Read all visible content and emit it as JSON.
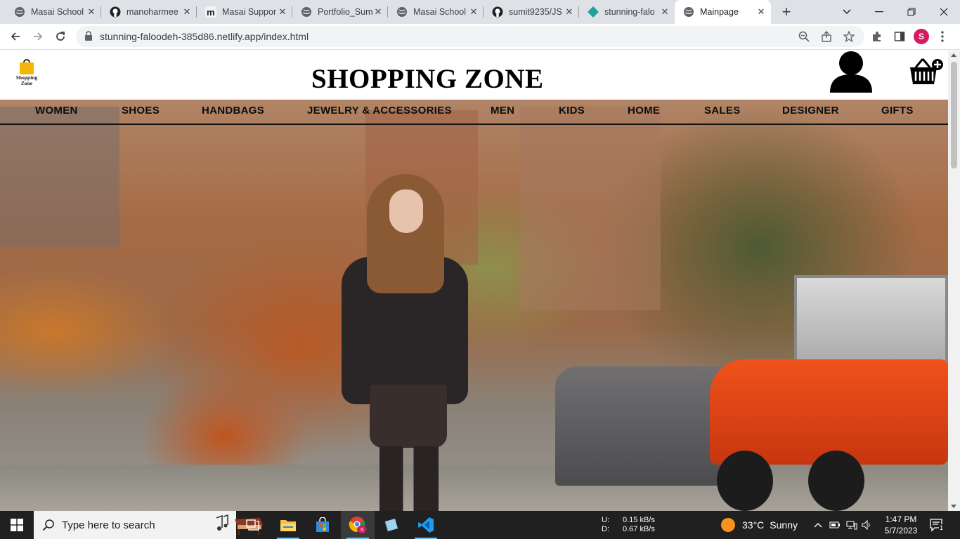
{
  "browser": {
    "tabs": [
      {
        "title": "Masai School",
        "icon": "globe-icon"
      },
      {
        "title": "manoharmee",
        "icon": "github-icon"
      },
      {
        "title": "Masai Suppor",
        "icon": "masai-m-icon"
      },
      {
        "title": "Portfolio_Sum",
        "icon": "globe-icon"
      },
      {
        "title": "Masai School",
        "icon": "globe-icon"
      },
      {
        "title": "sumit9235/JS",
        "icon": "github-icon"
      },
      {
        "title": "stunning-falo",
        "icon": "netlify-icon"
      },
      {
        "title": "Mainpage",
        "icon": "globe-icon",
        "active": true
      }
    ],
    "url": "stunning-faloodeh-385d86.netlify.app/index.html",
    "profile_initial": "S"
  },
  "site": {
    "logo_text": "Shopping Zone",
    "title": "SHOPPING ZONE",
    "categories": [
      "WOMEN",
      "SHOES",
      "HANDBAGS",
      "JEWELRY & ACCESSORIES",
      "MEN",
      "KIDS",
      "HOME",
      "SALES",
      "DESIGNER",
      "GIFTS"
    ]
  },
  "taskbar": {
    "search_placeholder": "Type here to search",
    "network": {
      "up_label": "U:",
      "up_value": "0.15 kB/s",
      "down_label": "D:",
      "down_value": "0.67 kB/s"
    },
    "weather": {
      "temp": "33°C",
      "condition": "Sunny"
    },
    "time": "1:47 PM",
    "date": "5/7/2023",
    "notification_count": "1"
  },
  "colors": {
    "tabstrip": "#dee1e6",
    "profile": "#d81b60",
    "taskbar": "#202020",
    "logo_bag": "#f2b705",
    "truck": "#f0521b"
  }
}
